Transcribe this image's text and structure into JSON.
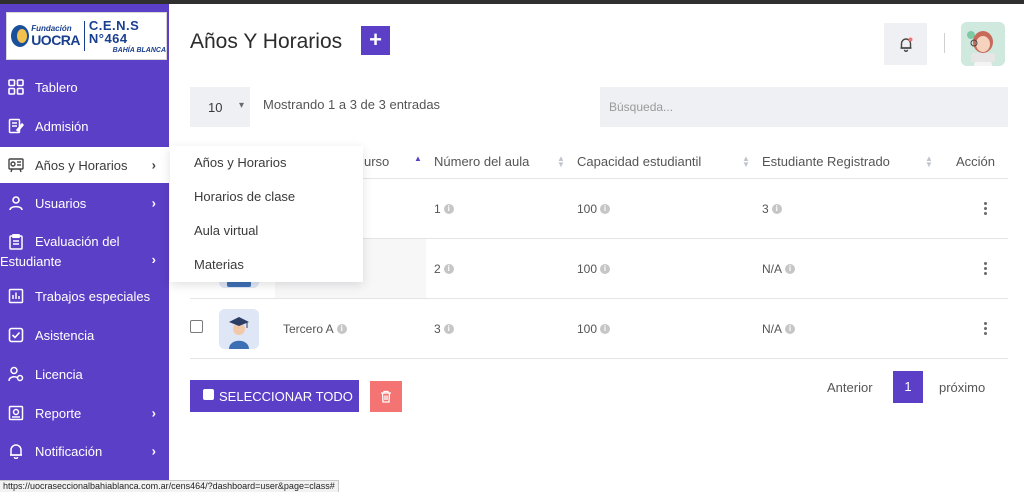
{
  "logo": {
    "fundacion": "Fundación",
    "uocra": "UOCRA",
    "cens": "C.E.N.S N°464",
    "city": "BAHÍA BLANCA"
  },
  "sidebar": {
    "items": [
      {
        "label": "Tablero",
        "icon": "dashboard-icon"
      },
      {
        "label": "Admisión",
        "icon": "admission-icon"
      },
      {
        "label": "Años y Horarios",
        "icon": "schedule-icon"
      },
      {
        "label": "Usuarios",
        "icon": "user-icon"
      },
      {
        "label_line1": "Evaluación del",
        "label_line2": "Estudiante",
        "icon": "evaluation-icon"
      },
      {
        "label": "Trabajos especiales",
        "icon": "special-work-icon"
      },
      {
        "label": "Asistencia",
        "icon": "attendance-icon"
      },
      {
        "label": "Licencia",
        "icon": "license-icon"
      },
      {
        "label": "Reporte",
        "icon": "report-icon"
      },
      {
        "label": "Notificación",
        "icon": "notification-icon"
      }
    ],
    "submenu": [
      "Años y Horarios",
      "Horarios de clase",
      "Aula virtual",
      "Materias"
    ]
  },
  "header": {
    "title": "Años Y Horarios",
    "add_label": "+"
  },
  "table_controls": {
    "page_length": "10",
    "info": "Mostrando 1 a 3 de 3 entradas",
    "search_placeholder": "Búsqueda..."
  },
  "table": {
    "headers": {
      "course": "urso",
      "classroom": "Número del aula",
      "capacity": "Capacidad estudiantil",
      "registered": "Estudiante Registrado",
      "action": "Acción"
    },
    "rows": [
      {
        "course": "",
        "classroom": "1",
        "capacity": "100",
        "registered": "3"
      },
      {
        "course": "",
        "classroom": "2",
        "capacity": "100",
        "registered": "N/A"
      },
      {
        "course": "Tercero A",
        "classroom": "3",
        "capacity": "100",
        "registered": "N/A"
      }
    ]
  },
  "actions": {
    "select_all": "SELECCIONAR TODO"
  },
  "pagination": {
    "prev": "Anterior",
    "current": "1",
    "next": "próximo"
  },
  "status_url": "https://uocraseccionalbahiablanca.com.ar/cens464/?dashboard=user&page=class#",
  "colors": {
    "primary": "#5b3fc6",
    "danger": "#f47474",
    "field_bg": "#eef0f4"
  }
}
